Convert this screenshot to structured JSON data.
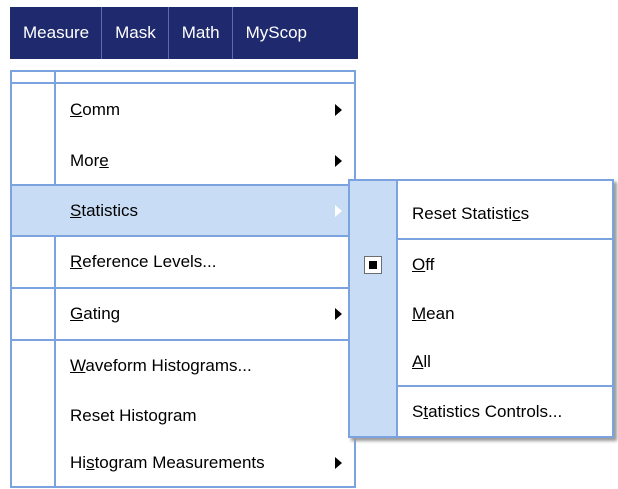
{
  "menubar": {
    "items": [
      {
        "label": "Measure"
      },
      {
        "label": "Mask"
      },
      {
        "label": "Math"
      },
      {
        "label": "MyScop"
      }
    ]
  },
  "measure_menu": {
    "items": [
      {
        "pre": "",
        "mn": "C",
        "post": "omm",
        "has_submenu": true
      },
      {
        "pre": "Mor",
        "mn": "e",
        "post": "",
        "has_submenu": true
      },
      {
        "pre": "",
        "mn": "S",
        "post": "tatistics",
        "has_submenu": true,
        "highlighted": true
      },
      {
        "pre": "",
        "mn": "R",
        "post": "eference Levels...",
        "has_submenu": false
      },
      {
        "pre": "",
        "mn": "G",
        "post": "ating",
        "has_submenu": true
      },
      {
        "pre": "",
        "mn": "W",
        "post": "aveform Histograms...",
        "has_submenu": false
      },
      {
        "pre": "Reset Histogram",
        "mn": "",
        "post": "",
        "has_submenu": false
      },
      {
        "pre": "Hi",
        "mn": "s",
        "post": "togram Measurements",
        "has_submenu": true
      }
    ]
  },
  "statistics_submenu": {
    "items": [
      {
        "pre": "Reset Statisti",
        "mn": "c",
        "post": "s",
        "selected": false
      },
      {
        "pre": "",
        "mn": "O",
        "post": "ff",
        "selected": true
      },
      {
        "pre": "",
        "mn": "M",
        "post": "ean",
        "selected": false
      },
      {
        "pre": "",
        "mn": "A",
        "post": "ll",
        "selected": false
      },
      {
        "pre": "S",
        "mn": "t",
        "post": "atistics Controls...",
        "selected": false
      }
    ]
  },
  "colors": {
    "menubar_bg": "#1f2a6e",
    "menu_border": "#7aa3e0",
    "highlight_bg": "#c9dcf6"
  }
}
